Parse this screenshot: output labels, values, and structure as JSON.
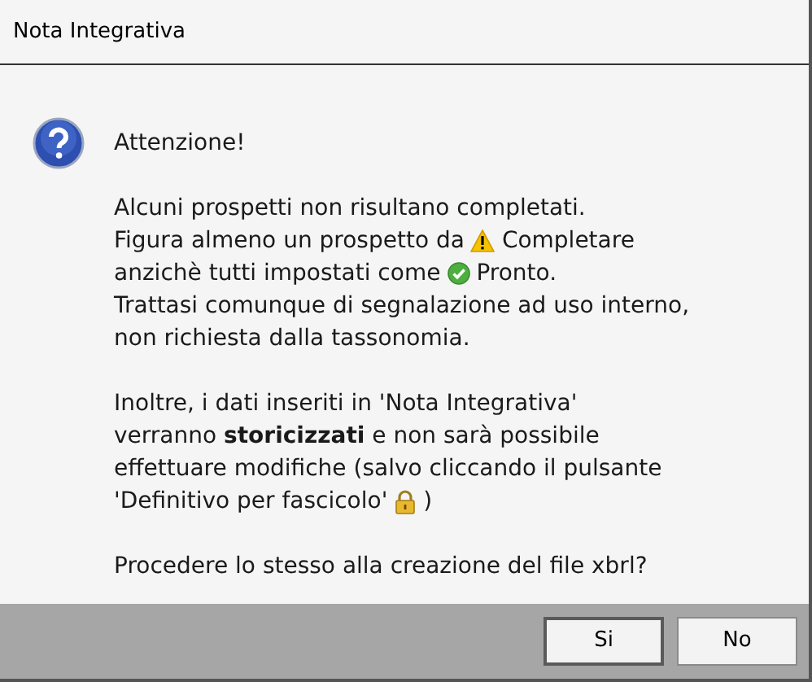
{
  "window": {
    "title": "Nota Integrativa"
  },
  "heading": "Attenzione!",
  "paragraphs": [
    {
      "lines": [
        [
          {
            "kind": "text",
            "text": "Alcuni prospetti non risultano completati."
          }
        ],
        [
          {
            "kind": "text",
            "text": "Figura almeno un prospetto da"
          },
          {
            "kind": "warning"
          },
          {
            "kind": "text",
            "text": "Completare"
          }
        ],
        [
          {
            "kind": "text",
            "text": "anzichè tutti impostati come"
          },
          {
            "kind": "check"
          },
          {
            "kind": "text",
            "text": "Pronto."
          }
        ],
        [
          {
            "kind": "text",
            "text": "Trattasi comunque di segnalazione ad uso interno,"
          }
        ],
        [
          {
            "kind": "text",
            "text": "non richiesta dalla tassonomia."
          }
        ]
      ]
    },
    {
      "lines": [
        [
          {
            "kind": "text",
            "text": "Inoltre, i dati inseriti in 'Nota Integrativa'"
          }
        ],
        [
          {
            "kind": "text",
            "text": "verranno **storicizzati** e non sarà possibile"
          }
        ],
        [
          {
            "kind": "text",
            "text": "effettuare modifiche (salvo cliccando il pulsante"
          }
        ],
        [
          {
            "kind": "text",
            "text": "'Definitivo per fascicolo'"
          },
          {
            "kind": "lock"
          },
          {
            "kind": "text",
            "text": ")"
          }
        ]
      ]
    },
    {
      "lines": [
        [
          {
            "kind": "text",
            "text": "Procedere lo stesso alla creazione del file xbrl?"
          }
        ]
      ]
    }
  ],
  "buttons": [
    "Si",
    "No"
  ]
}
